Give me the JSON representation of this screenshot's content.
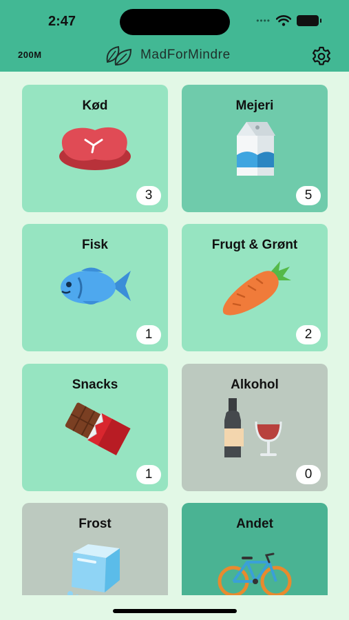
{
  "status_bar": {
    "time": "2:47"
  },
  "header": {
    "zoom": "200M",
    "app_name": "MadForMindre"
  },
  "colors": {
    "header": "#42b894",
    "background": "#e2f8e6",
    "card_light": "#96e4c1",
    "card_medium": "#6fcbab",
    "card_gray": "#bcc9bf",
    "card_dark": "#4ab393"
  },
  "categories": [
    {
      "label": "Kød",
      "count": "3",
      "icon": "steak-icon"
    },
    {
      "label": "Mejeri",
      "count": "5",
      "icon": "milk-carton-icon"
    },
    {
      "label": "Fisk",
      "count": "1",
      "icon": "fish-icon"
    },
    {
      "label": "Frugt & Grønt",
      "count": "2",
      "icon": "carrot-icon"
    },
    {
      "label": "Snacks",
      "count": "1",
      "icon": "chocolate-icon"
    },
    {
      "label": "Alkohol",
      "count": "0",
      "icon": "wine-icon"
    },
    {
      "label": "Frost",
      "icon": "ice-cube-icon"
    },
    {
      "label": "Andet",
      "icon": "bicycle-icon"
    }
  ]
}
